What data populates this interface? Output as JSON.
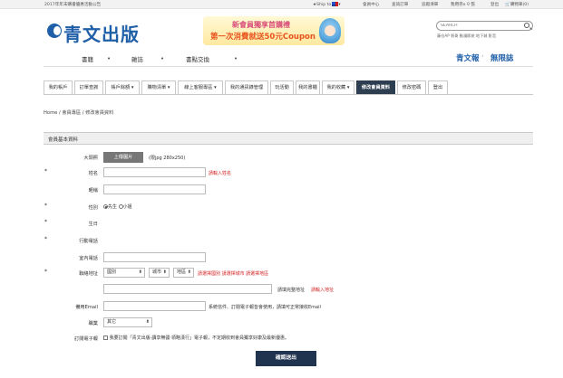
{
  "topbar": {
    "notice": "2017年年末購書優惠活動公告",
    "ship_to": "Ship to",
    "links": [
      "會員中心",
      "查詢訂單",
      "追蹤清單",
      "我用券x 0 張",
      "登出"
    ],
    "cart": "購物車(0)"
  },
  "header": {
    "logo_text": "青文出版",
    "banner_line1": "新會員獨享首購禮",
    "banner_line2": "第一次消費就送50元Coupon",
    "search_placeholder": "SEARCH",
    "hotwords": "藤仓AP  帆哥  動漫節旅  地下城  影音",
    "nav": [
      "書籍",
      "雜誌",
      "書點交換"
    ],
    "brand_links": [
      "青文報",
      "無限誌"
    ]
  },
  "tabs": [
    "我的帳戶",
    "訂單查詢",
    "帳戶餘額",
    "購物清單",
    "線上客服專區",
    "我的通訊錄管理",
    "玩活動",
    "我的書櫃",
    "我的收藏",
    "修改會員資料",
    "修改密碼",
    "登出"
  ],
  "breadcrumb": "Home  /  會員專區  /  修改會員資料",
  "form": {
    "section_title": "會員基本資料",
    "avatar_label": "大頭照",
    "upload_button": "上傳圖片",
    "upload_hint": "(限jpg 280x250)",
    "name_label": "姓名",
    "name_error": "請輸入姓名",
    "nickname_label": "暱稱",
    "gender_label": "性別",
    "gender_options": [
      "先生",
      "小姐"
    ],
    "birthday_label": "生日",
    "mobile_label": "行動電話",
    "phone_label": "室內電話",
    "address_label": "聯絡地址",
    "country_value": "國別",
    "city_value": "城市",
    "district_value": "地區",
    "address_select_error": "請選擇國別 請選擇城市 請選擇地區",
    "address_full_note": "請填完整地址",
    "address_full_error": "請輸入地址",
    "email_label": "備用Email",
    "email_note": "系統信件、訂閱電子報皆會使用，請填可正常接收Email",
    "job_label": "職業",
    "job_value": "其它",
    "newsletter_label": "訂閱電子報",
    "newsletter_text": "我要訂閱「青文出版-讀享無疆‧領略漢行」電子報，不定期收到會員獨享好康及最新優惠。",
    "submit_label": "確認送出"
  }
}
